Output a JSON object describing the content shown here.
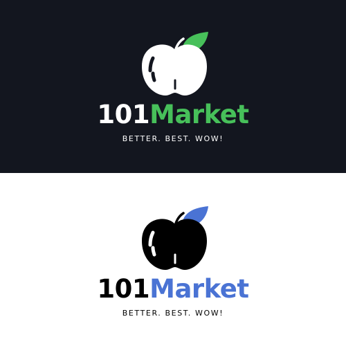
{
  "logos": [
    {
      "variant": "dark",
      "background": "#13161f",
      "apple_color": "#ffffff",
      "apple_shine": "#13161f",
      "leaf_color": "#47c05a",
      "number_text": "101",
      "number_color": "#ffffff",
      "brand_text": "Market",
      "brand_color": "#47c05a",
      "tagline": "BETTER. BEST. WOW!",
      "tagline_color": "#ffffff",
      "icon": "apple-icon"
    },
    {
      "variant": "light",
      "background": "#ffffff",
      "apple_color": "#000000",
      "apple_shine": "#ffffff",
      "leaf_color": "#4a73d4",
      "number_text": "101",
      "number_color": "#000000",
      "brand_text": "Market",
      "brand_color": "#4a73d4",
      "tagline": "BETTER. BEST. WOW!",
      "tagline_color": "#000000",
      "icon": "apple-icon"
    }
  ]
}
